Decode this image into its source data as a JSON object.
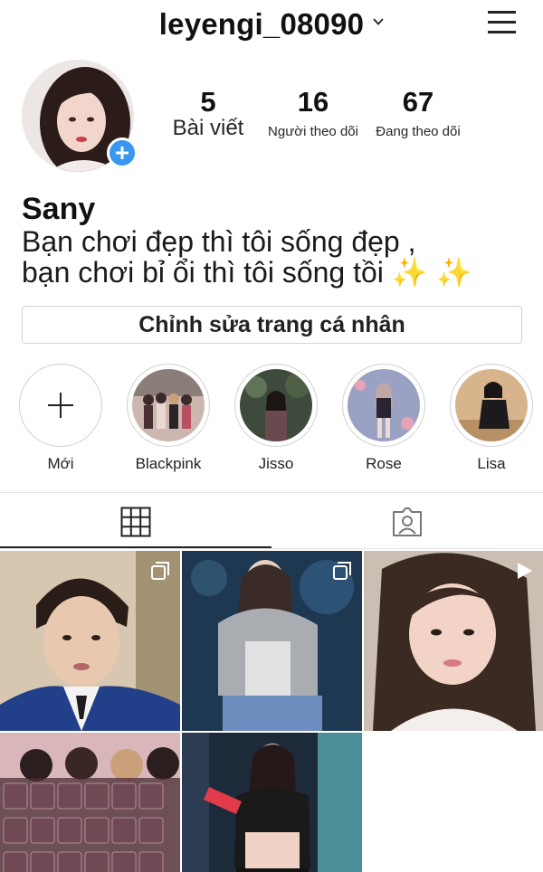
{
  "header": {
    "username": "leyengi_08090",
    "icons": {
      "dropdown": "chevron-down-icon",
      "menu": "hamburger-menu-icon"
    }
  },
  "profile": {
    "stats": [
      {
        "value": "5",
        "label": "Bài viết"
      },
      {
        "value": "16",
        "label": "Người theo dõi"
      },
      {
        "value": "67",
        "label": "Đang theo dõi"
      }
    ],
    "name": "Sany",
    "bio_line1": "Bạn chơi đẹp thì tôi sống đẹp ,",
    "bio_line2": "bạn chơi bỉ ổi thì tôi sống tồi",
    "bio_emoji": "✨ ✨",
    "edit_button": "Chỉnh sửa trang cá nhân"
  },
  "highlights": [
    {
      "label": "Mới",
      "type": "new"
    },
    {
      "label": "Blackpink"
    },
    {
      "label": "Jisso"
    },
    {
      "label": "Rose"
    },
    {
      "label": "Lisa"
    }
  ],
  "tabs": [
    {
      "name": "grid",
      "icon": "grid-icon",
      "active": true
    },
    {
      "name": "tagged",
      "icon": "tagged-person-icon",
      "active": false
    }
  ],
  "posts": [
    {
      "overlay": "multi-photo-icon"
    },
    {
      "overlay": "multi-photo-icon"
    },
    {
      "overlay": "video-play-icon"
    },
    {
      "overlay": ""
    },
    {
      "overlay": ""
    }
  ],
  "colors": {
    "accent": "#3897f0",
    "text": "#262626",
    "border": "#dbdbdb"
  }
}
